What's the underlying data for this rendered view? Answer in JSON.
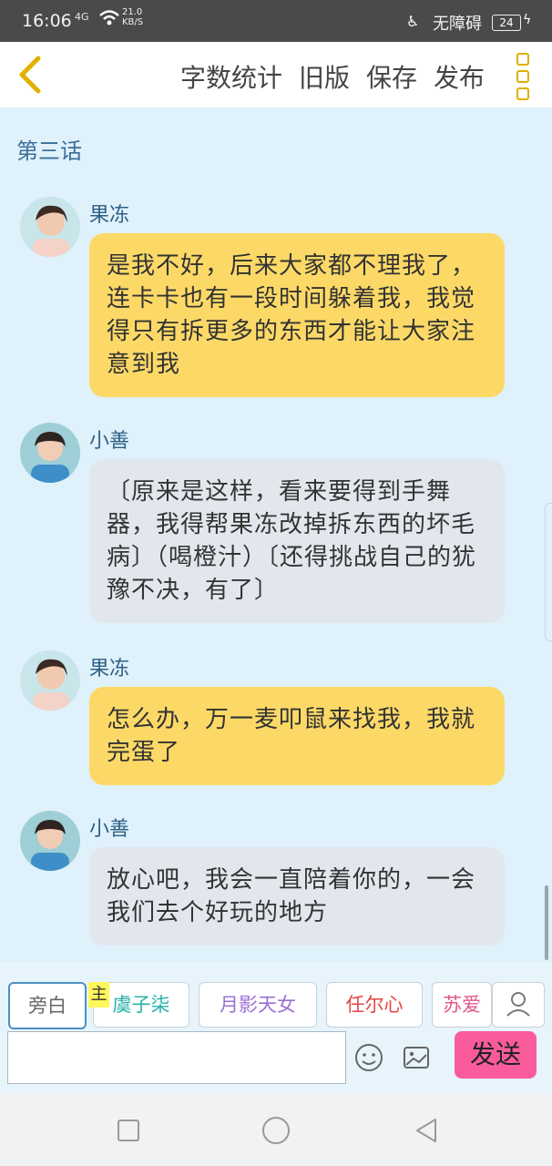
{
  "status_bar": {
    "time": "16:06",
    "network": "4G",
    "speed_value": "21.0",
    "speed_unit": "KB/S",
    "accessibility_label": "无障碍",
    "battery": "24"
  },
  "toolbar": {
    "actions": [
      "字数统计",
      "旧版",
      "保存",
      "发布"
    ]
  },
  "chapter_title": "第三话",
  "messages": [
    {
      "speaker": "果冻",
      "text": "是我不好，后来大家都不理我了，连卡卡也有一段时间躲着我，我觉得只有拆更多的东西才能让大家注意到我"
    },
    {
      "speaker": "小善",
      "text": "〔原来是这样，看来要得到手舞器，我得帮果冻改掉拆东西的坏毛病〕（喝橙汁）〔还得挑战自己的犹豫不决，有了〕"
    },
    {
      "speaker": "果冻",
      "text": "怎么办，万一麦叩鼠来找我，我就完蛋了"
    },
    {
      "speaker": "小善",
      "text": "放心吧，我会一直陪着你的，一会我们去个好玩的地方"
    }
  ],
  "character_chips": [
    {
      "label": "旁白",
      "color": "#666666"
    },
    {
      "label": "虞子柒",
      "color": "#27b2a8"
    },
    {
      "label": "月影天女",
      "color": "#9b6fd6"
    },
    {
      "label": "任尔心",
      "color": "#e44646"
    },
    {
      "label": "苏爱",
      "color": "#e2578c"
    }
  ],
  "main_tag": "主",
  "composer": {
    "placeholder": "",
    "send_label": "发送"
  },
  "colors": {
    "accent_yellow": "#fcd967",
    "send_pink": "#f95b9c",
    "name_blue": "#2e5f86"
  }
}
